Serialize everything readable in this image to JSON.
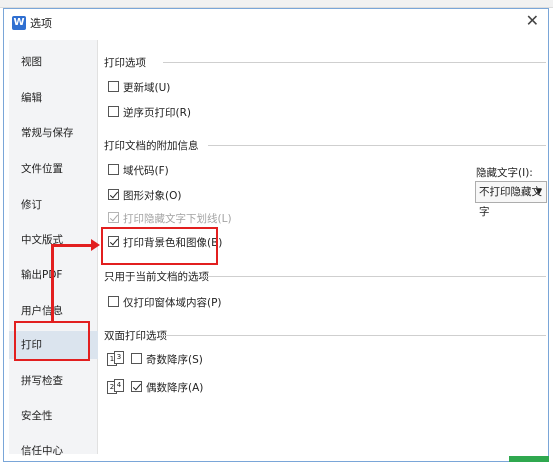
{
  "window": {
    "title": "选项",
    "app_icon_letter": "W",
    "close_glyph": "✕"
  },
  "sidebar": {
    "items": [
      {
        "label": "视图"
      },
      {
        "label": "编辑"
      },
      {
        "label": "常规与保存"
      },
      {
        "label": "文件位置"
      },
      {
        "label": "修订"
      },
      {
        "label": "中文版式"
      },
      {
        "label": "输出PDF"
      },
      {
        "label": "用户信息"
      },
      {
        "label": "打印",
        "active": true
      },
      {
        "label": "拼写检查"
      },
      {
        "label": "安全性"
      },
      {
        "label": "信任中心"
      }
    ]
  },
  "print_options": {
    "title": "打印选项",
    "update_fields": {
      "label": "更新域(U)",
      "checked": false
    },
    "reverse_order": {
      "label": "逆序页打印(R)",
      "checked": false
    }
  },
  "doc_extras": {
    "title": "打印文档的附加信息",
    "field_codes": {
      "label": "域代码(F)",
      "checked": false
    },
    "drawing_objects": {
      "label": "图形对象(O)",
      "checked": true
    },
    "hidden_underline": {
      "label": "打印隐藏文字下划线(L)",
      "checked": true,
      "disabled": true
    },
    "background": {
      "label": "打印背景色和图像(B)",
      "checked": true
    },
    "hidden_text_label": "隐藏文字(I):",
    "hidden_text_value": "不打印隐藏文字",
    "dropdown_arrow": "▼"
  },
  "current_doc": {
    "title": "只用于当前文档的选项",
    "form_data": {
      "label": "仅打印窗体域内容(P)",
      "checked": false
    }
  },
  "duplex": {
    "title": "双面打印选项",
    "odd": {
      "label": "奇数降序(S)",
      "checked": false
    },
    "even": {
      "label": "偶数降序(A)",
      "checked": true
    },
    "icon_pages_odd": [
      "1",
      "3"
    ],
    "icon_pages_even": [
      "2",
      "4"
    ]
  },
  "colors": {
    "highlight": "#e21f1f",
    "active_bg": "#dbe4ee",
    "accent": "#2f6fd1"
  }
}
